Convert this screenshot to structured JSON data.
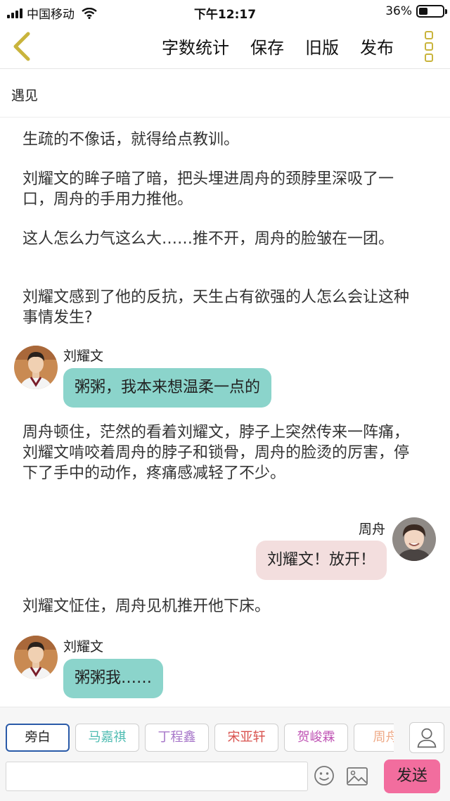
{
  "status_bar": {
    "carrier": "中国移动",
    "time": "下午12:17",
    "battery_text": "36%",
    "battery_level": 0.36
  },
  "nav": {
    "back_icon": "chevron-left-icon",
    "actions": [
      "字数统计",
      "保存",
      "旧版",
      "发布"
    ],
    "more_icon": "vertical-dots-icon"
  },
  "title": "遇见",
  "story": {
    "paragraphs": [
      "生疏的不像话，就得给点教训。",
      "刘耀文的眸子暗了暗，把头埋进周舟的颈脖里深吸了一口，周舟的手用力推他。",
      "这人怎么力气这么大……推不开，周舟的脸皱在一团。",
      "刘耀文感到了他的反抗，天生占有欲强的人怎么会让这种事情发生?",
      "周舟顿住，茫然的看着刘耀文，脖子上突然传来一阵痛，刘耀文啃咬着周舟的脖子和锁骨，周舟的脸烫的厉害，停下了手中的动作，疼痛感减轻了不少。",
      "刘耀文怔住，周舟见机推开他下床。"
    ],
    "messages": [
      {
        "speaker": "刘耀文",
        "text": "粥粥，我本来想温柔一点的",
        "side": "left"
      },
      {
        "speaker": "周舟",
        "text": "刘耀文！放开！",
        "side": "right"
      },
      {
        "speaker": "刘耀文",
        "text": "粥粥我……",
        "side": "left"
      }
    ]
  },
  "characters": [
    {
      "name": "旁白",
      "color": "#222222"
    },
    {
      "name": "马嘉祺",
      "color": "#4fbcb2"
    },
    {
      "name": "丁程鑫",
      "color": "#a777c9"
    },
    {
      "name": "宋亚轩",
      "color": "#d9534f"
    },
    {
      "name": "贺峻霖",
      "color": "#c056b5"
    },
    {
      "name": "周舟",
      "color": "#eeaa88"
    }
  ],
  "input": {
    "placeholder": "",
    "send_label": "发送",
    "emoji_icon": "smiley-icon",
    "image_icon": "image-icon",
    "person_icon": "person-icon"
  },
  "colors": {
    "left_bubble": "#8bd4cb",
    "right_bubble": "#f3dede",
    "send_button": "#f26d9e",
    "accent_gold": "#c9b43c"
  }
}
